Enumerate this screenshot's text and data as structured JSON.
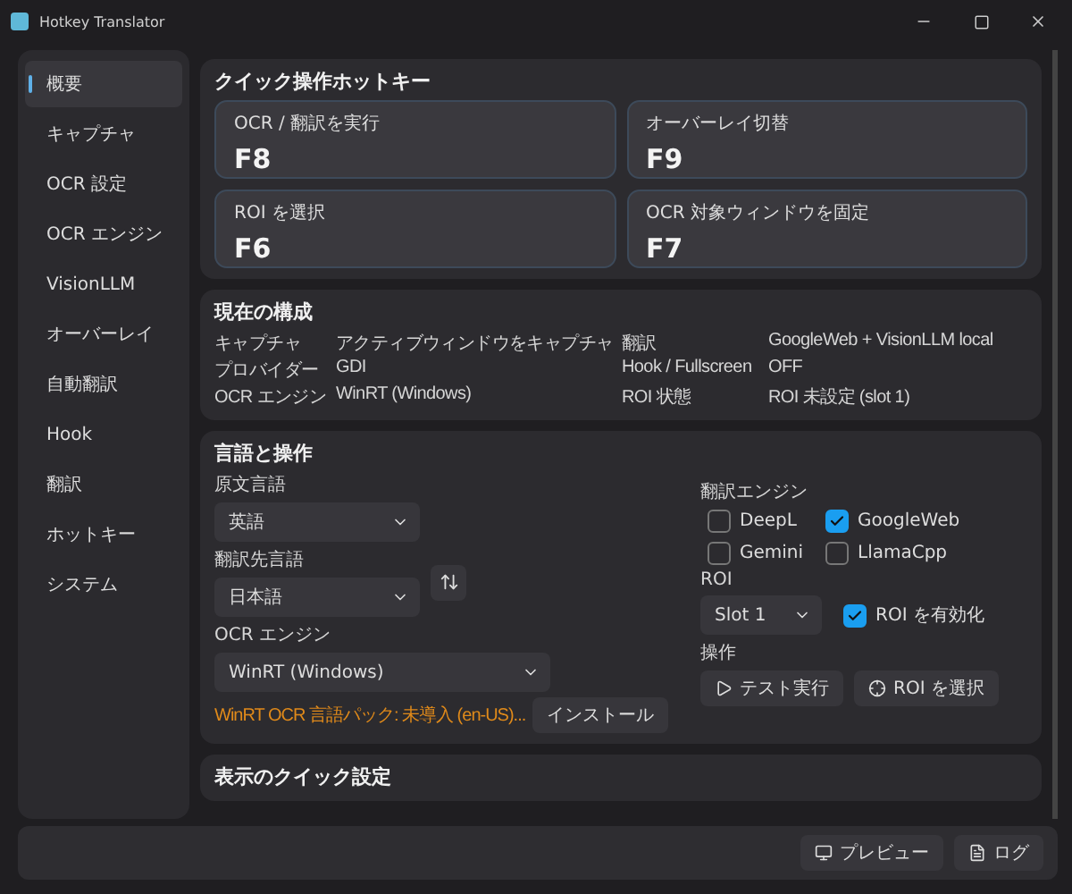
{
  "window": {
    "title": "Hotkey Translator"
  },
  "sidebar": {
    "items": [
      {
        "label": "概要",
        "selected": true
      },
      {
        "label": "キャプチャ",
        "selected": false
      },
      {
        "label": "OCR 設定",
        "selected": false
      },
      {
        "label": "OCR エンジン",
        "selected": false
      },
      {
        "label": "VisionLLM",
        "selected": false
      },
      {
        "label": "オーバーレイ",
        "selected": false
      },
      {
        "label": "自動翻訳",
        "selected": false
      },
      {
        "label": "Hook",
        "selected": false
      },
      {
        "label": "翻訳",
        "selected": false
      },
      {
        "label": "ホットキー",
        "selected": false
      },
      {
        "label": "システム",
        "selected": false
      }
    ]
  },
  "hotkeys": {
    "title": "クイック操作ホットキー",
    "items": [
      {
        "label": "OCR / 翻訳を実行",
        "key": "F8"
      },
      {
        "label": "オーバーレイ切替",
        "key": "F9"
      },
      {
        "label": "ROI を選択",
        "key": "F6"
      },
      {
        "label": "OCR 対象ウィンドウを固定",
        "key": "F7"
      }
    ]
  },
  "config": {
    "title": "現在の構成",
    "rows": [
      {
        "label": "キャプチャ",
        "value": "アクティブウィンドウをキャプチャ",
        "label_2": "翻訳",
        "value_2": "GoogleWeb + VisionLLM local"
      },
      {
        "label": "プロバイダー",
        "value": "GDI",
        "label_2": "Hook / Fullscreen",
        "value_2": "OFF"
      },
      {
        "label": "OCR エンジン",
        "value": "WinRT (Windows)",
        "label_2": "ROI 状態",
        "value_2": "ROI 未設定 (slot 1)"
      }
    ]
  },
  "language": {
    "title": "言語と操作",
    "source_label": "原文言語",
    "source": "英語",
    "target_label": "翻訳先言語",
    "target": "日本語",
    "ocr_label": "OCR エンジン",
    "ocr": "WinRT (Windows)",
    "warning": "WinRT OCR 言語パック: 未導入 (en-US)...",
    "install": "インストール",
    "engines_label": "翻訳エンジン",
    "engines": [
      {
        "label": "DeepL",
        "checked": false
      },
      {
        "label": "GoogleWeb",
        "checked": true
      },
      {
        "label": "Gemini",
        "checked": false
      },
      {
        "label": "LlamaCpp",
        "checked": false
      }
    ],
    "roi_label": "ROI",
    "roi_slot": "Slot 1",
    "roi_enable": {
      "label": "ROI を有効化",
      "checked": true
    },
    "actions_label": "操作",
    "actions": [
      {
        "kind": "play",
        "label": "テスト実行"
      },
      {
        "kind": "target",
        "label": "ROI を選択"
      }
    ]
  },
  "display": {
    "title": "表示のクイック設定"
  },
  "footer": {
    "buttons": [
      {
        "kind": "preview",
        "label": "プレビュー"
      },
      {
        "kind": "log",
        "label": "ログ"
      }
    ]
  }
}
